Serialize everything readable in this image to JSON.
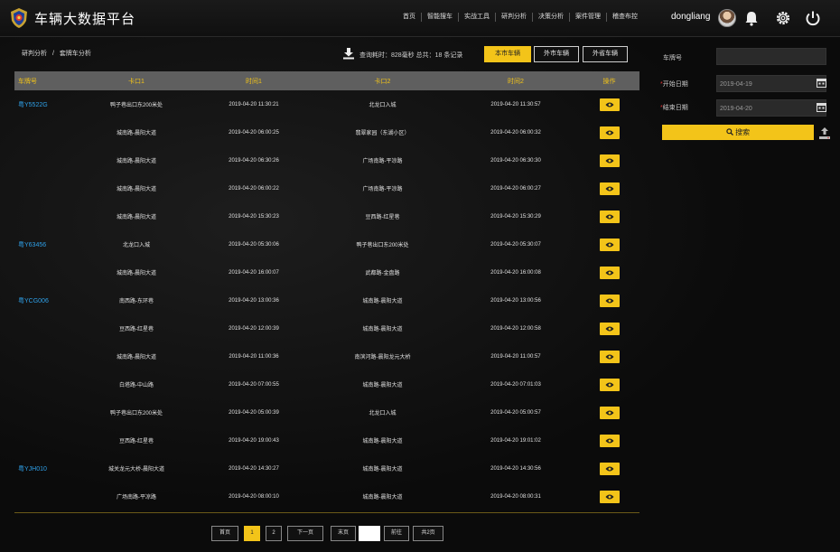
{
  "app": {
    "title": "车辆大数据平台"
  },
  "nav": [
    "首页",
    "智能搜车",
    "实战工具",
    "研判分析",
    "决策分析",
    "案件管理",
    "稽查布控"
  ],
  "user": {
    "name": "dongliang"
  },
  "breadcrumb": {
    "parent": "研判分析",
    "separator": "/",
    "current": "套牌车分析"
  },
  "stats": {
    "text": "查询耗时：828毫秒 总共：18 条记录"
  },
  "tabs": [
    {
      "label": "本市车辆",
      "active": true
    },
    {
      "label": "外市车辆",
      "active": false
    },
    {
      "label": "外省车辆",
      "active": false
    }
  ],
  "table": {
    "columns": [
      "车牌号",
      "卡口1",
      "时间1",
      "卡口2",
      "时间2",
      "操作"
    ],
    "rows": [
      {
        "plate": "粤Y5522G",
        "loc1": "鸭子巷出口东200米处",
        "time1": "2019-04-20 11:30:21",
        "loc2": "北龙口入城",
        "time2": "2019-04-20 11:30:57"
      },
      {
        "plate": "",
        "loc1": "城南路-晨阳大道",
        "time1": "2019-04-20 06:00:25",
        "loc2": "翡翠家园（东湖小区）",
        "time2": "2019-04-20 06:00:32"
      },
      {
        "plate": "",
        "loc1": "城南路-晨阳大道",
        "time1": "2019-04-20 06:30:26",
        "loc2": "广场南路-平凉路",
        "time2": "2019-04-20 06:30:30"
      },
      {
        "plate": "",
        "loc1": "城南路-晨阳大道",
        "time1": "2019-04-20 06:00:22",
        "loc2": "广场南路-平凉路",
        "time2": "2019-04-20 06:00:27"
      },
      {
        "plate": "",
        "loc1": "城南路-晨阳大道",
        "time1": "2019-04-20 15:30:23",
        "loc2": "豆西路-红星巷",
        "time2": "2019-04-20 15:30:29"
      },
      {
        "plate": "粤Y63456",
        "loc1": "北龙口入城",
        "time1": "2019-04-20 05:30:06",
        "loc2": "鸭子巷出口东200米处",
        "time2": "2019-04-20 05:30:07"
      },
      {
        "plate": "",
        "loc1": "城南路-晨阳大道",
        "time1": "2019-04-20 16:00:07",
        "loc2": "武都路-金盘路",
        "time2": "2019-04-20 16:00:08"
      },
      {
        "plate": "粤YCG006",
        "loc1": "南西路-东环巷",
        "time1": "2019-04-20 13:00:36",
        "loc2": "城南路-晨阳大道",
        "time2": "2019-04-20 13:00:56"
      },
      {
        "plate": "",
        "loc1": "豆西路-红星巷",
        "time1": "2019-04-20 12:00:39",
        "loc2": "城南路-晨阳大道",
        "time2": "2019-04-20 12:00:58"
      },
      {
        "plate": "",
        "loc1": "城南路-晨阳大道",
        "time1": "2019-04-20 11:00:36",
        "loc2": "南滨河路-晨阳龙元大桥",
        "time2": "2019-04-20 11:00:57"
      },
      {
        "plate": "",
        "loc1": "白塔路-中山路",
        "time1": "2019-04-20 07:00:55",
        "loc2": "城南路-晨阳大道",
        "time2": "2019-04-20 07:01:03"
      },
      {
        "plate": "",
        "loc1": "鸭子巷出口东200米处",
        "time1": "2019-04-20 05:00:39",
        "loc2": "北龙口入城",
        "time2": "2019-04-20 05:00:57"
      },
      {
        "plate": "",
        "loc1": "豆西路-红星巷",
        "time1": "2019-04-20 19:00:43",
        "loc2": "城南路-晨阳大道",
        "time2": "2019-04-20 19:01:02"
      },
      {
        "plate": "粤YJH010",
        "loc1": "城关龙元大桥-晨阳大道",
        "time1": "2019-04-20 14:30:27",
        "loc2": "城南路-晨阳大道",
        "time2": "2019-04-20 14:30:56"
      },
      {
        "plate": "",
        "loc1": "广场南路-平凉路",
        "time1": "2019-04-20 08:00:10",
        "loc2": "城南路-晨阳大道",
        "time2": "2019-04-20 08:00:31"
      }
    ]
  },
  "pagination": {
    "first": "首页",
    "page1": "1",
    "page2": "2",
    "next": "下一页",
    "last": "末页",
    "goto_value": "",
    "go": "前往",
    "total": "共2页"
  },
  "form": {
    "plate_label": "车牌号",
    "plate_value": "",
    "start_label": "开始日期",
    "start_value": "2019-04-19",
    "end_label": "结束日期",
    "end_value": "2019-04-20",
    "required_mark": "*",
    "search_label": "搜索"
  },
  "colors": {
    "accent": "#f3c419",
    "plate": "#2fa0e8",
    "header_bg": "#5f5f5f"
  }
}
